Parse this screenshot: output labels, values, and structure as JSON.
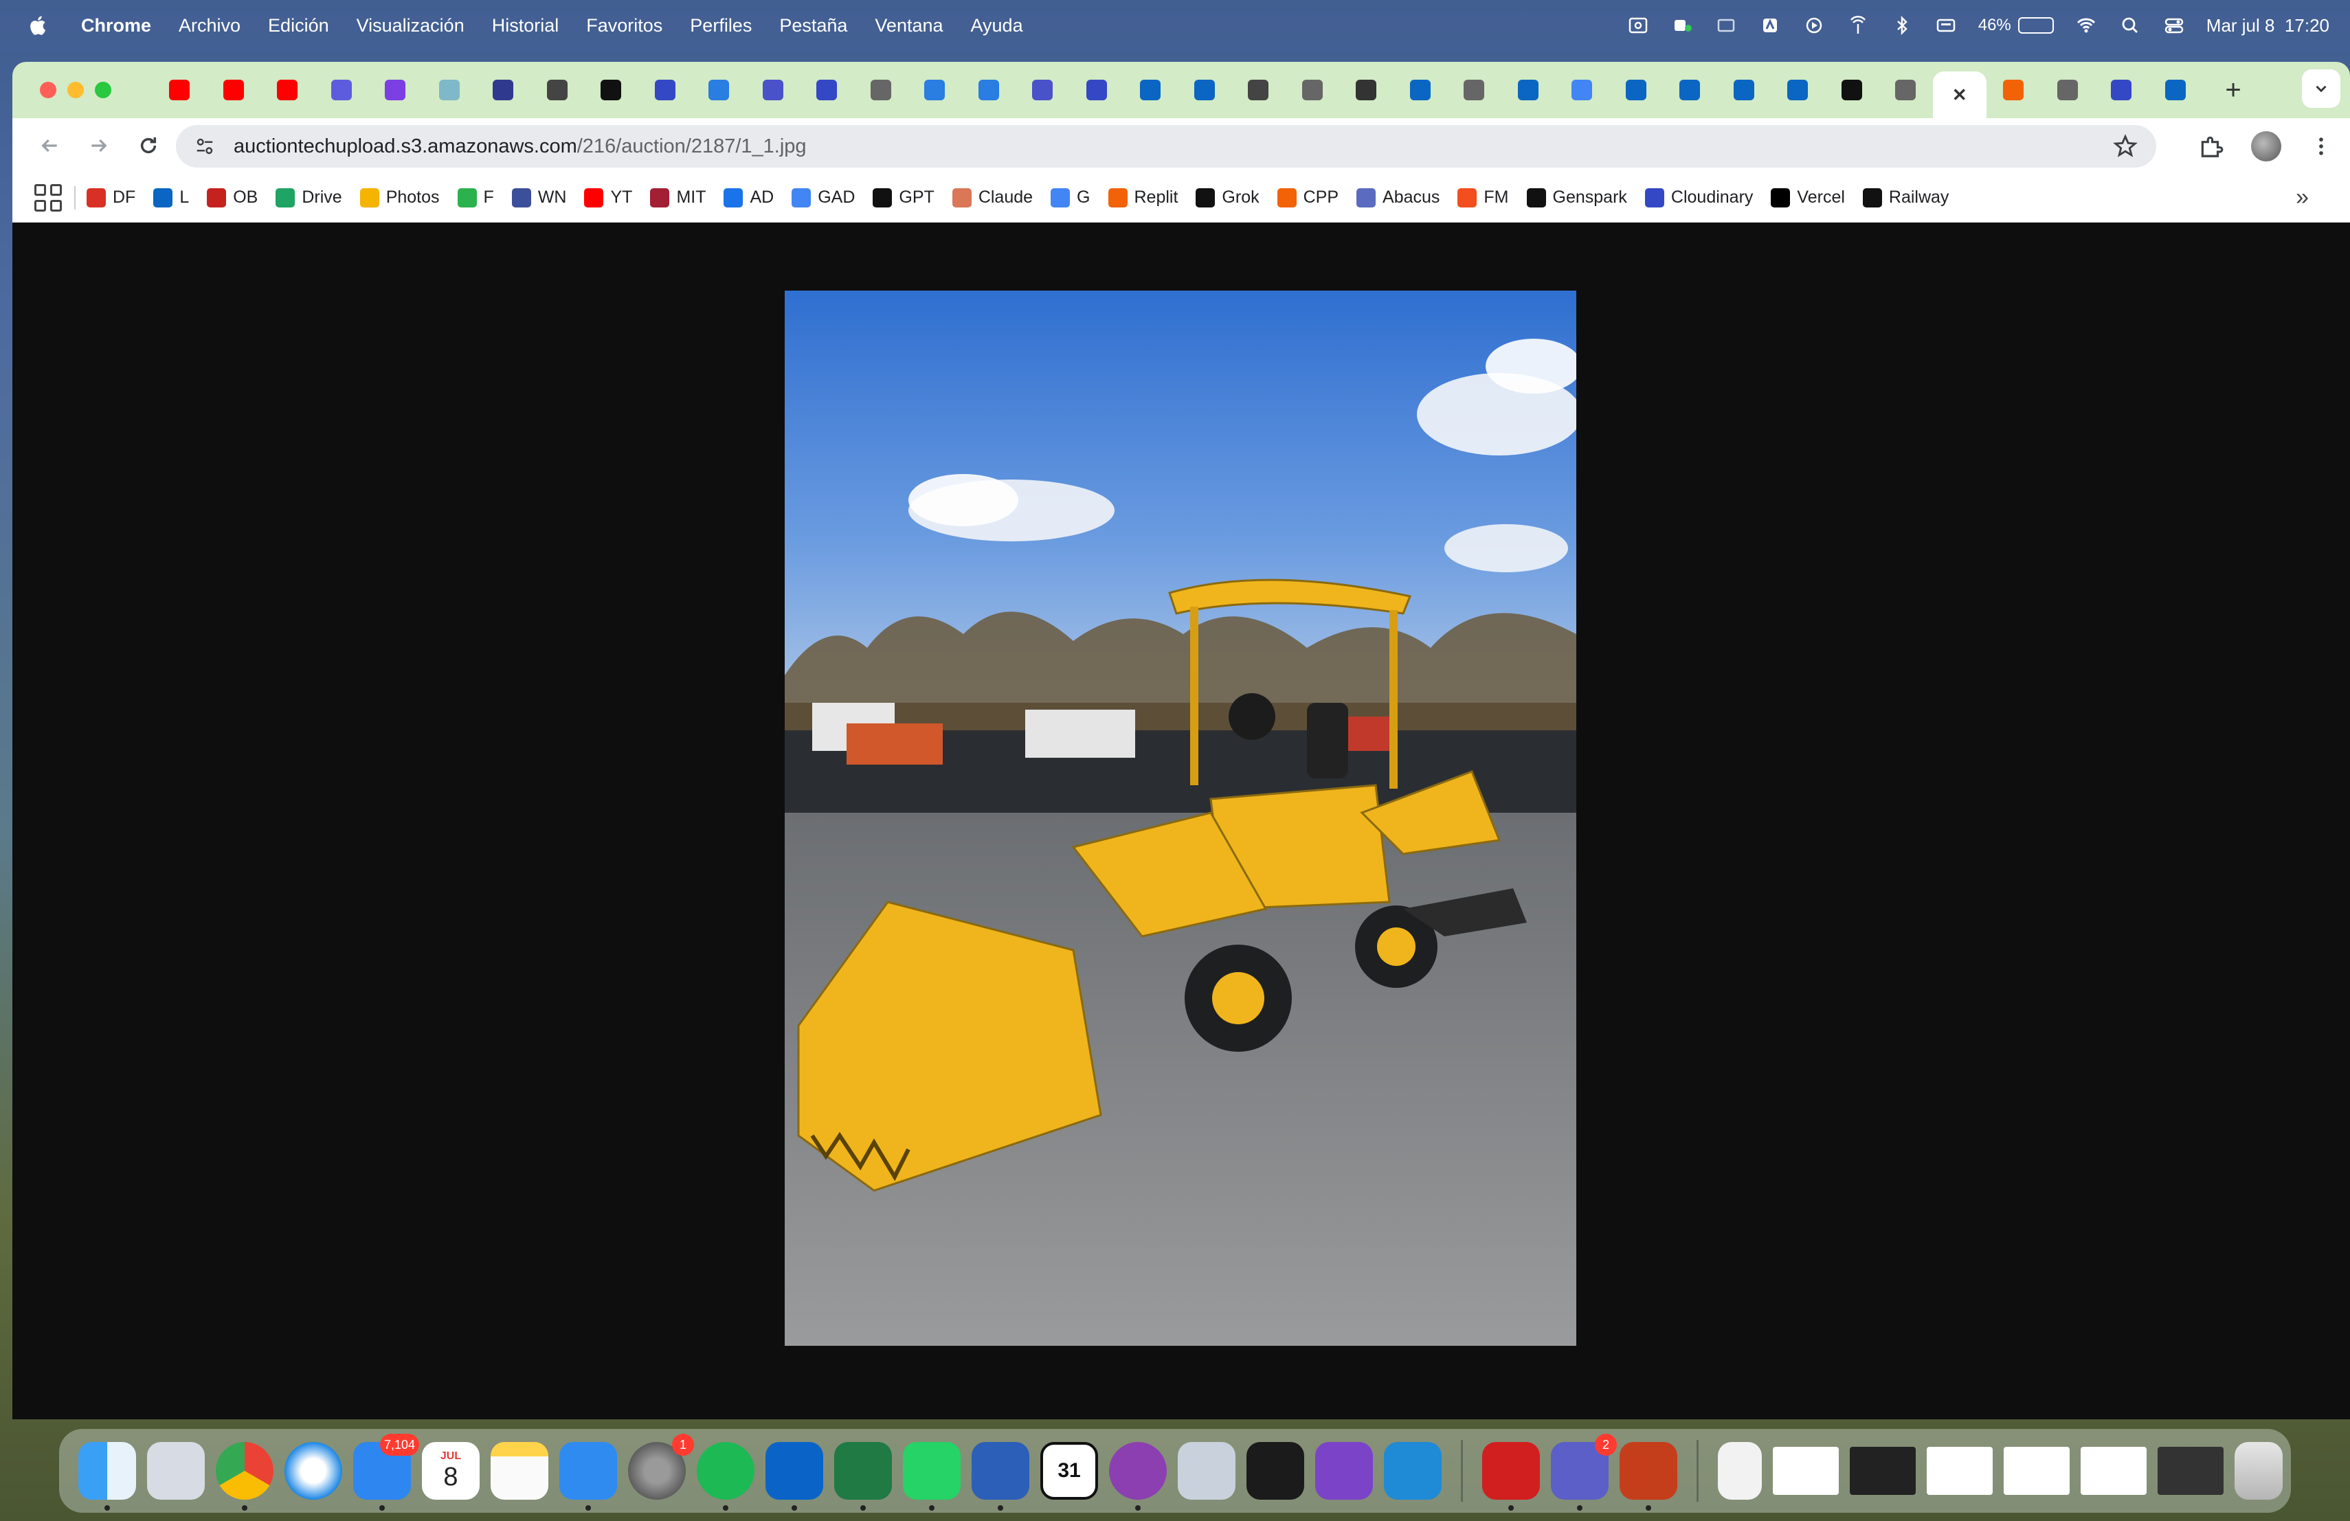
{
  "menubar": {
    "app_name": "Chrome",
    "items": [
      "Archivo",
      "Edición",
      "Visualización",
      "Historial",
      "Favoritos",
      "Perfiles",
      "Pestaña",
      "Ventana",
      "Ayuda"
    ],
    "battery_percent": "46%",
    "battery_level": 0.46,
    "datetime": "Mar jul 8  17:20"
  },
  "tabs": {
    "count": 37,
    "active_index": 34,
    "favicons": [
      "youtube-icon",
      "youtube-icon",
      "youtube-icon",
      "poe-icon",
      "perplexity-icon",
      "wave-icon",
      "shield-icon",
      "circle-icon",
      "openai-icon",
      "cloudinary-icon",
      "copilot-icon",
      "slides-icon",
      "cloudinary-icon",
      "globe-icon",
      "copilot-icon",
      "copilot-icon",
      "slides-icon",
      "cloudinary-icon",
      "linkedin-icon",
      "linkedin-icon",
      "circle-icon",
      "globe-icon",
      "chrome-icon",
      "linkedin-icon",
      "globe-icon",
      "linkedin-icon",
      "google-icon",
      "linkedin-icon",
      "linkedin-icon",
      "linkedin-icon",
      "linkedin-icon",
      "openai-icon",
      "globe-icon",
      "close-icon",
      "replit-icon",
      "globe-icon",
      "cloudinary-icon",
      "linkedin-icon"
    ]
  },
  "address_bar": {
    "host": "auctiontechupload.s3.amazonaws.com",
    "path": "/216/auction/2187/1_1.jpg"
  },
  "bookmarks": [
    {
      "label": "DF",
      "icon": "df-icon",
      "color": "#d93025"
    },
    {
      "label": "L",
      "icon": "linkedin-icon",
      "color": "#0a66c2"
    },
    {
      "label": "OB",
      "icon": "ob-icon",
      "color": "#c5221f"
    },
    {
      "label": "Drive",
      "icon": "drive-icon",
      "color": "#1fa463"
    },
    {
      "label": "Photos",
      "icon": "photos-icon",
      "color": "#f4b400"
    },
    {
      "label": "F",
      "icon": "feedly-icon",
      "color": "#2bb24c"
    },
    {
      "label": "WN",
      "icon": "wn-icon",
      "color": "#3c4f9a"
    },
    {
      "label": "YT",
      "icon": "youtube-icon",
      "color": "#ff0000"
    },
    {
      "label": "MIT",
      "icon": "mit-icon",
      "color": "#a31f34"
    },
    {
      "label": "AD",
      "icon": "ad-icon",
      "color": "#1a73e8"
    },
    {
      "label": "GAD",
      "icon": "google-icon",
      "color": "#4285f4"
    },
    {
      "label": "GPT",
      "icon": "openai-icon",
      "color": "#111111"
    },
    {
      "label": "Claude",
      "icon": "claude-icon",
      "color": "#d97757"
    },
    {
      "label": "G",
      "icon": "gemini-icon",
      "color": "#4285f4"
    },
    {
      "label": "Replit",
      "icon": "replit-icon",
      "color": "#f26207"
    },
    {
      "label": "Grok",
      "icon": "grok-icon",
      "color": "#111111"
    },
    {
      "label": "CPP",
      "icon": "cpp-icon",
      "color": "#f26207"
    },
    {
      "label": "Abacus",
      "icon": "abacus-icon",
      "color": "#5b6bc0"
    },
    {
      "label": "FM",
      "icon": "figma-icon",
      "color": "#f24e1e"
    },
    {
      "label": "Genspark",
      "icon": "genspark-icon",
      "color": "#111111"
    },
    {
      "label": "Cloudinary",
      "icon": "cloudinary-icon",
      "color": "#3448c5"
    },
    {
      "label": "Vercel",
      "icon": "vercel-icon",
      "color": "#000000"
    },
    {
      "label": "Railway",
      "icon": "railway-icon",
      "color": "#111111"
    }
  ],
  "dock": {
    "mail_badge": "7,104",
    "calendar_month": "JUL",
    "calendar_day": "8",
    "settings_badge": "1",
    "teams_badge": "2",
    "cal31_label": "31"
  },
  "colors": {
    "tabstrip": "#d3ebc6",
    "page_background": "#0e0e0e",
    "loader_yellow": "#f0b51c"
  }
}
